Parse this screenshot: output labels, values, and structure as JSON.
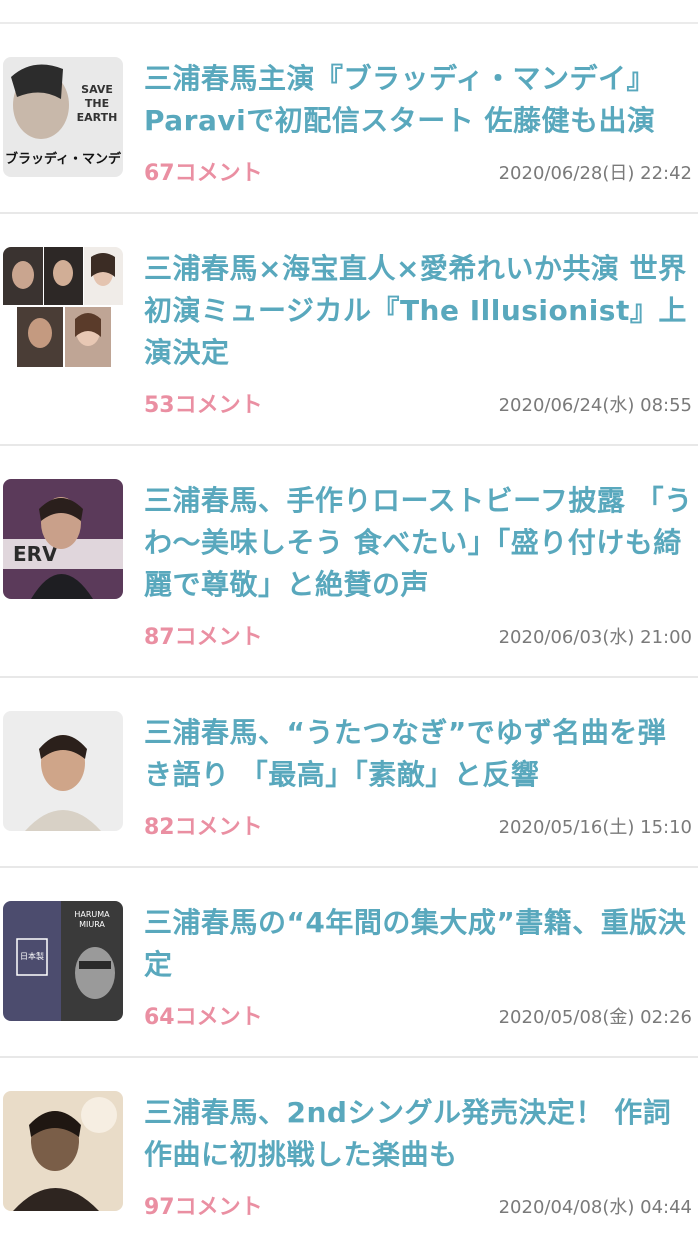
{
  "articles": [
    {
      "title": "三浦春馬主演『ブラッディ・マンデイ』Paraviで初配信スタート 佐藤健も出演",
      "comments": "67コメント",
      "date": "2020/06/28(日) 22:42",
      "thumb_text_1": "SAVE",
      "thumb_text_2": "THE",
      "thumb_text_3": "EARTH",
      "thumb_text_4": "ブラッディ・マンデ"
    },
    {
      "title": "三浦春馬×海宝直人×愛希れいか共演 世界初演ミュージカル『The Illusionist』上演決定",
      "comments": "53コメント",
      "date": "2020/06/24(水) 08:55"
    },
    {
      "title": "三浦春馬、手作りローストビーフ披露 「うわ〜美味しそう 食べたい」「盛り付けも綺麗で尊敬」と絶賛の声",
      "comments": "87コメント",
      "date": "2020/06/03(水) 21:00"
    },
    {
      "title": "三浦春馬、“うたつなぎ”でゆず名曲を弾き語り 「最高」「素敵」と反響",
      "comments": "82コメント",
      "date": "2020/05/16(土) 15:10"
    },
    {
      "title": "三浦春馬の“4年間の集大成”書籍、重版決定",
      "comments": "64コメント",
      "date": "2020/05/08(金) 02:26",
      "thumb_text_1": "HARUMA",
      "thumb_text_2": "MIURA",
      "thumb_text_3": "日本製"
    },
    {
      "title": "三浦春馬、2ndシングル発売決定！ 作詞作曲に初挑戦した楽曲も",
      "comments": "97コメント",
      "date": "2020/04/08(水) 04:44"
    }
  ],
  "colors": {
    "title": "#59a8bd",
    "comments": "#ea8fa2",
    "date": "#7a7a7a"
  }
}
